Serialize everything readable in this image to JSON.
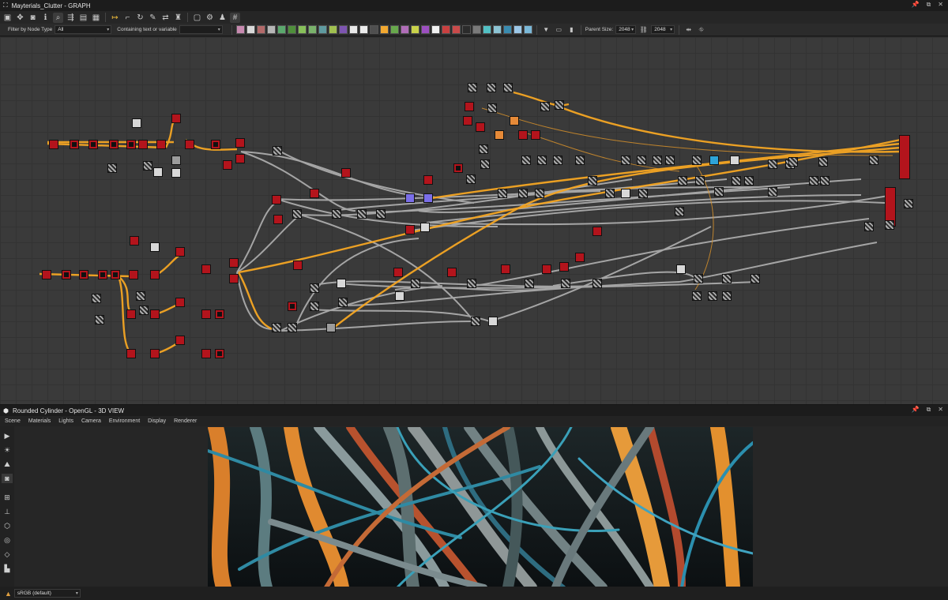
{
  "graph_window": {
    "title": "Mayterials_Clutter - GRAPH"
  },
  "toolbar": {
    "icons": [
      "frame-icon",
      "fit-icon",
      "camera-icon",
      "info-icon",
      "search-icon",
      "graph-layout-icon",
      "node-icon",
      "arrow-right-icon",
      "link-icon",
      "rotate-icon",
      "wrench-icon",
      "toggle-icon",
      "brush-icon",
      "grid-icon"
    ]
  },
  "filter_bar": {
    "filter_label": "Filter by Node Type",
    "filter_value": "All",
    "search_label": "Containing text or variable",
    "search_value": "",
    "parent_size_label": "Parent Size:",
    "parent_size_value": "2048",
    "output_size_value": "2048",
    "colors": [
      "#c88ab0",
      "#d9d9d9",
      "#b36a6a",
      "#b6b6b6",
      "#5ba86d",
      "#4f8f3b",
      "#87c05a",
      "#7ab26b",
      "#5f9a9f",
      "#a0c050",
      "#7d55b0",
      "#e8e8e8",
      "#ececec",
      "#4f4f4f",
      "#f2a830",
      "#68a84c",
      "#b06db8",
      "#c9d24a",
      "#9c4fc0",
      "#f0f0f0",
      "#c94040",
      "#c94a4a",
      "#2b2b2b",
      "#7a7a7a",
      "#52c0c4",
      "#8cc4d4",
      "#3a8cb0",
      "#9cc8e8",
      "#7ab8d8"
    ]
  },
  "view_window": {
    "title": "Rounded Cylinder - OpenGL - 3D VIEW"
  },
  "view_menu": {
    "items": [
      "Scene",
      "Materials",
      "Lights",
      "Camera",
      "Environment",
      "Display",
      "Renderer"
    ]
  },
  "status": {
    "colorspace": "sRGB (default)"
  },
  "palette": {
    "node_red": "#b3141c",
    "wire_gray": "#b8b8b8",
    "wire_orange": "#f5a623",
    "accent_blue": "#2ea3d8"
  }
}
